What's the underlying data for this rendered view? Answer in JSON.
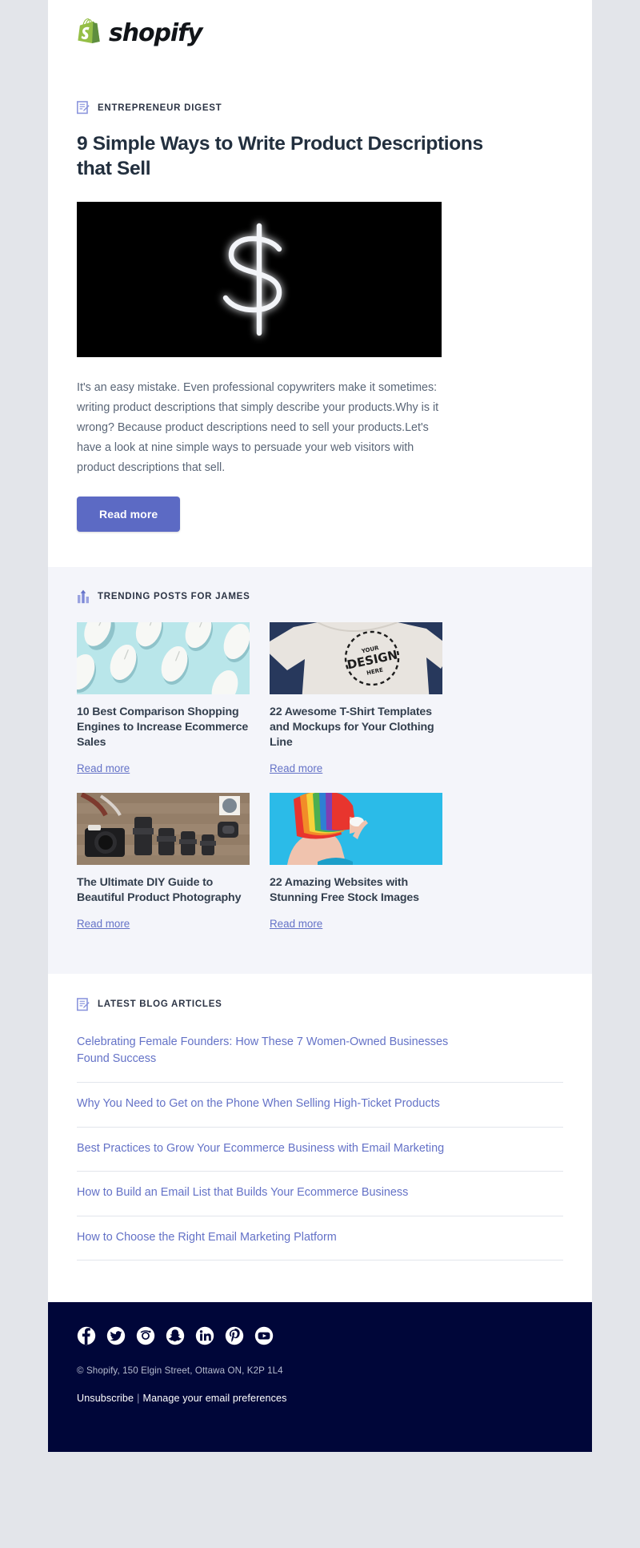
{
  "brand": {
    "name": "shopify",
    "logo_green_light": "#95bf47",
    "logo_green_dark": "#5e8e3e",
    "accent": "#5c6ac4",
    "link_color": "#6472c7",
    "footer_bg": "#000639",
    "trending_bg": "#f4f5fa"
  },
  "feature": {
    "eyebrow": "ENTREPRENEUR DIGEST",
    "eyebrow_icon": "memo-icon",
    "headline": "9 Simple Ways to Write Product Descriptions that Sell",
    "hero_image_alt": "neon dollar sign on black background",
    "body": "It's an easy mistake. Even professional copywriters make it sometimes: writing product descriptions that simply describe your products.Why is it wrong? Because product descriptions need to sell your products.Let's have a look at nine simple ways to persuade your web visitors with product descriptions that sell.",
    "cta_label": "Read more"
  },
  "trending": {
    "heading": "TRENDING POSTS FOR JAMES",
    "heading_icon": "trending-chart-icon",
    "read_more_label": "Read more",
    "posts": [
      {
        "title": "10 Best Comparison Shopping Engines to Increase Ecommerce Sales",
        "image_alt": "white computer mice on mint background",
        "link_label": "Read more"
      },
      {
        "title": "22 Awesome T-Shirt Templates and Mockups for Your Clothing Line",
        "image_alt": "t-shirt mockup with YOUR DESIGN HERE stamp",
        "link_label": "Read more"
      },
      {
        "title": "The Ultimate DIY Guide to Beautiful Product Photography",
        "image_alt": "camera and lenses on wooden table",
        "link_label": "Read more"
      },
      {
        "title": "22 Amazing Websites with Stunning Free Stock Images",
        "image_alt": "woman with rainbow wig on blue background",
        "link_label": "Read more"
      }
    ]
  },
  "latest": {
    "heading": "LATEST BLOG ARTICLES",
    "heading_icon": "memo-icon",
    "articles": [
      "Celebrating Female Founders: How These 7 Women-Owned Businesses Found Success",
      "Why You Need to Get on the Phone When Selling High-Ticket Products",
      "Best Practices to Grow Your Ecommerce Business with Email Marketing",
      "How to Build an Email List that Builds Your Ecommerce Business",
      "How to Choose the Right Email Marketing Platform"
    ]
  },
  "footer": {
    "social": [
      "facebook-icon",
      "twitter-icon",
      "instagram-icon",
      "snapchat-icon",
      "linkedin-icon",
      "pinterest-icon",
      "youtube-icon"
    ],
    "copyright": "© Shopify,  150 Elgin Street, Ottawa ON, K2P 1L4",
    "unsubscribe_label": "Unsubscribe",
    "separator": "|",
    "preferences_label": "Manage your email preferences"
  }
}
